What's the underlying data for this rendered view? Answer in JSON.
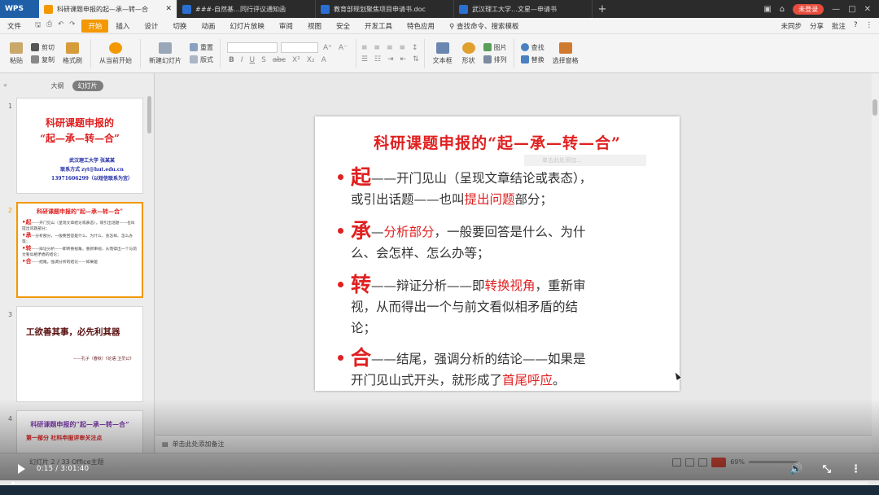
{
  "app": {
    "logo": "WPS"
  },
  "tabs": [
    {
      "label": "科研课题申报的起—承—转—合",
      "active": true,
      "color": "#f39800"
    },
    {
      "label": "###-自然基…同行评议通知函",
      "active": false,
      "color": "#2a6fd1"
    },
    {
      "label": "教育部规划聚焦项目申请书.doc",
      "active": false,
      "color": "#2a6fd1"
    },
    {
      "label": "武汉理工大学…文星—申请书",
      "active": false,
      "color": "#2a6fd1"
    }
  ],
  "window": {
    "login": "未登录"
  },
  "menu": {
    "file": "文件",
    "items": [
      "开始",
      "插入",
      "设计",
      "切换",
      "动画",
      "幻灯片放映",
      "审阅",
      "视图",
      "安全",
      "开发工具",
      "特色应用"
    ],
    "search": "查找命令、搜索模板",
    "right": [
      "未同步",
      "分享",
      "批注"
    ]
  },
  "ribbon": {
    "paste": "粘贴",
    "cut": "剪切",
    "copy": "复制",
    "format_painter": "格式刷",
    "from_current": "从当前开始",
    "new_slide": "新建幻灯片",
    "layout": "版式",
    "reset": "重置",
    "text_box": "文本框",
    "shape": "形状",
    "picture": "图片",
    "arrange": "排列",
    "find": "查找",
    "replace": "替换",
    "select_pane": "选择窗格"
  },
  "panel": {
    "outline": "大纲",
    "slides": "幻灯片"
  },
  "thumbs": {
    "t1": {
      "num": "1",
      "line1": "科研课题申报的",
      "line2": "“起—承—转—合”",
      "author": "武汉理工大学   张某某",
      "email": "联系方式  zyt@hut.edu.cn",
      "phone": "13971606299（以短信联系为宜）"
    },
    "t2": {
      "num": "2",
      "title": "科研课题申报的“起—承—转—合”",
      "l1": "——开门见山（呈现文章结论或表态），或引出话题——也叫提出问题部分；",
      "l2": "—分析部分，一般要回答是什么、为什么、会怎样、怎么办等；",
      "l3": "——辩证分析——即转换视角，重新审视，从而得出一个与前文看似相矛盾的结论；",
      "l4": "——结尾，强调分析的结论——如果是"
    },
    "t3": {
      "num": "3",
      "title": "工欲善其事，必先利其器",
      "source": "——孔子（春秋）《论语·卫灵公》"
    },
    "t4": {
      "num": "4",
      "title": "科研课题申报的“起—承—转—合”",
      "sub": "第一部分    社科申报评审关注点"
    }
  },
  "slide": {
    "title": "科研课题申报的“起—承—转—合”",
    "placeholder": "单击此处添加...",
    "b1": {
      "key": "起",
      "t1": "——开门见山（呈现文章结论或表态），",
      "t2": "或引出话题——也叫",
      "hl": "提出问题",
      "t3": "部分；"
    },
    "b2": {
      "key": "承",
      "t1": "—",
      "hl": "分析部分",
      "t2": "，一般要回答是什么、为什",
      "t3": "么、会怎样、怎么办等；"
    },
    "b3": {
      "key": "转",
      "t1": "——辩证分析——即",
      "hl": "转换视角",
      "t2": "，重新审",
      "t3": "视，从而得出一个与前文看似相矛盾的结",
      "t4": "论；"
    },
    "b4": {
      "key": "合",
      "t1": "——结尾，强调分析的结论——如果是",
      "t2": "开门见山式开头，就形成了",
      "hl": "首尾呼应",
      "t3": "。"
    }
  },
  "notes": {
    "text": "单击此处添加备注"
  },
  "status": {
    "left": "幻灯片 2 / 33   Office主题",
    "zoom": "69%"
  },
  "video": {
    "time": "0:15 / 3:01:40",
    "progress_fraction": 0.002
  }
}
